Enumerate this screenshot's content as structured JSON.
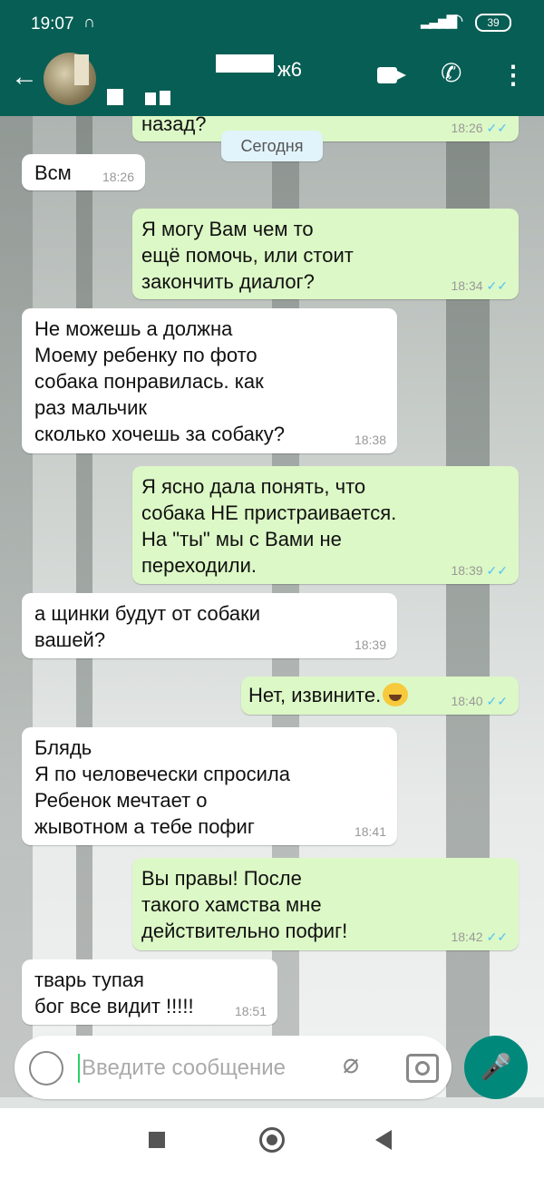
{
  "status_bar": {
    "time": "19:07",
    "headphones_icon": "headphones-icon",
    "battery": "39"
  },
  "header": {
    "contact_suffix": "ж6"
  },
  "chat": {
    "date_label": "Сегодня",
    "messages": [
      {
        "dir": "out",
        "text": "назад?",
        "time": "18:26"
      },
      {
        "dir": "in",
        "text": "Всм",
        "time": "18:26"
      },
      {
        "dir": "out",
        "text": "Я могу Вам чем то\nещё помочь, или стоит\nзакончить диалог?",
        "time": "18:34"
      },
      {
        "dir": "in",
        "text": "Не можешь а должна\nМоему ребенку по фото\nсобака понравилась. как\nраз мальчик\nсколько хочешь за собаку?",
        "time": "18:38"
      },
      {
        "dir": "out",
        "text": "Я ясно дала понять, что\nсобака НЕ пристраивается.\nНа \"ты\" мы с Вами не\nпереходили.",
        "time": "18:39"
      },
      {
        "dir": "in",
        "text": "а щинки будут от собаки\nвашей?",
        "time": "18:39"
      },
      {
        "dir": "out",
        "text": "Нет, извините.",
        "emoji": "face-with-tears-of-joy",
        "time": "18:40"
      },
      {
        "dir": "in",
        "text": "Блядь\nЯ по человечески спросила\nРебенок мечтает о\nжывотном а тебе пофиг",
        "time": "18:41"
      },
      {
        "dir": "out",
        "text": "Вы правы! После\nтакого хамства мне\nдействительно пофиг!",
        "time": "18:42"
      },
      {
        "dir": "in",
        "text": "тварь тупая\nбог все видит !!!!!",
        "time": "18:51"
      }
    ]
  },
  "input": {
    "placeholder": "Введите сообщение"
  },
  "colors": {
    "header": "#075e54",
    "outgoing": "#dcf8c6",
    "incoming": "#ffffff",
    "accent": "#00897b",
    "ticks": "#4fc3f7"
  }
}
